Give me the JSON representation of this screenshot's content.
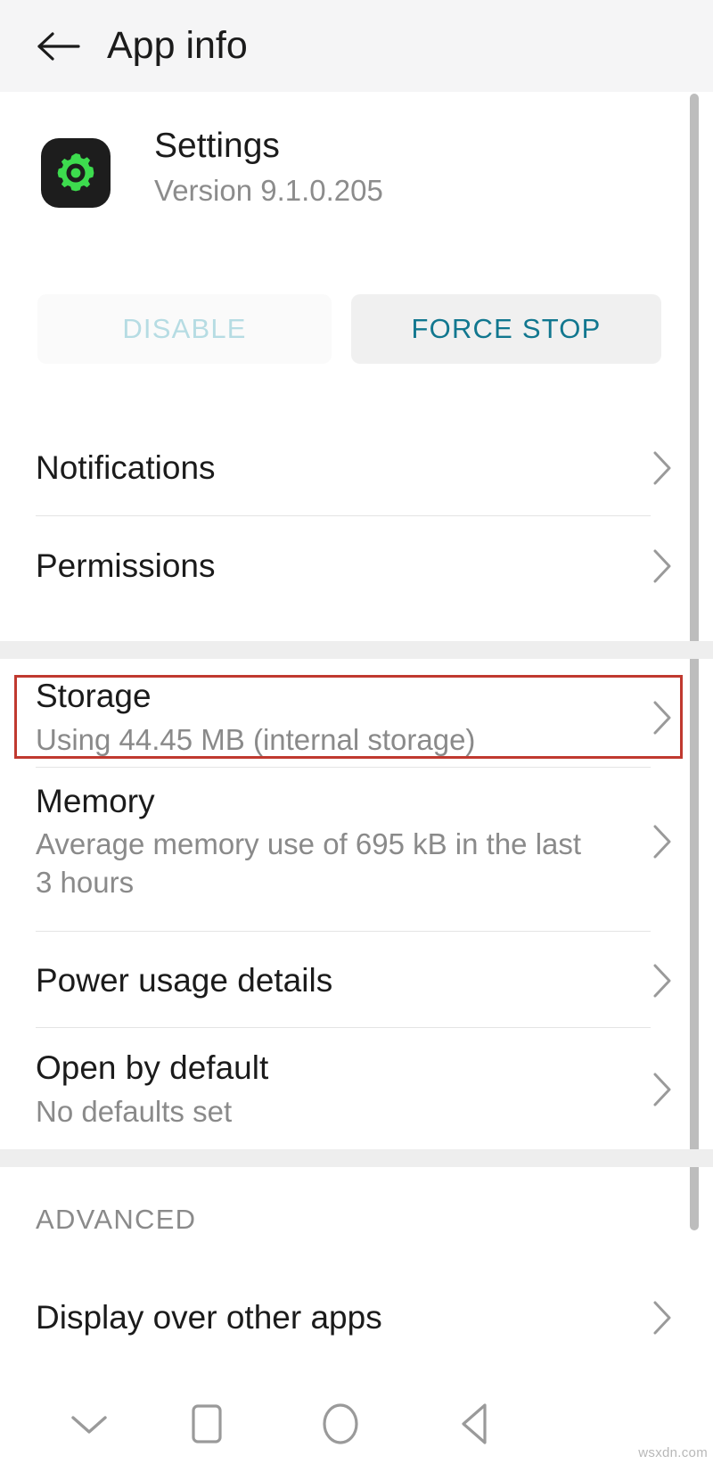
{
  "appbar": {
    "title": "App info",
    "back_icon": "arrow-left-icon"
  },
  "app_header": {
    "icon": "settings-gear-icon",
    "name": "Settings",
    "version": "Version 9.1.0.205"
  },
  "actions": {
    "disable_label": "DISABLE",
    "force_stop_label": "FORCE STOP"
  },
  "rows": [
    {
      "title": "Notifications",
      "subtitle": ""
    },
    {
      "title": "Permissions",
      "subtitle": ""
    },
    {
      "title": "Storage",
      "subtitle": "Using 44.45 MB (internal storage)"
    },
    {
      "title": "Memory",
      "subtitle": "Average memory use of 695 kB in the last 3 hours"
    },
    {
      "title": "Power usage details",
      "subtitle": ""
    },
    {
      "title": "Open by default",
      "subtitle": "No defaults set"
    },
    {
      "title": "Display over other apps",
      "subtitle": ""
    }
  ],
  "sections": {
    "advanced_label": "ADVANCED"
  },
  "navbar": {
    "hide_keyboard_icon": "chevron-down-icon",
    "recents_icon": "square-icon",
    "home_icon": "circle-icon",
    "back_icon": "triangle-left-icon"
  },
  "annotation": {
    "target": "Storage",
    "color": "#c0392f"
  },
  "watermark": "wsxdn.com",
  "colors": {
    "appbar_bg": "#f5f5f6",
    "content_bg": "#ffffff",
    "band_bg": "#eeeeee",
    "primary_text": "#1b1b1b",
    "secondary_text": "#8a8a8a",
    "accent_teal": "#11778f",
    "disabled_teal": "#b6dce3",
    "icon_bg": "#1d1d1d",
    "icon_green": "#3ddb4e",
    "annotation_red": "#c0392f"
  }
}
